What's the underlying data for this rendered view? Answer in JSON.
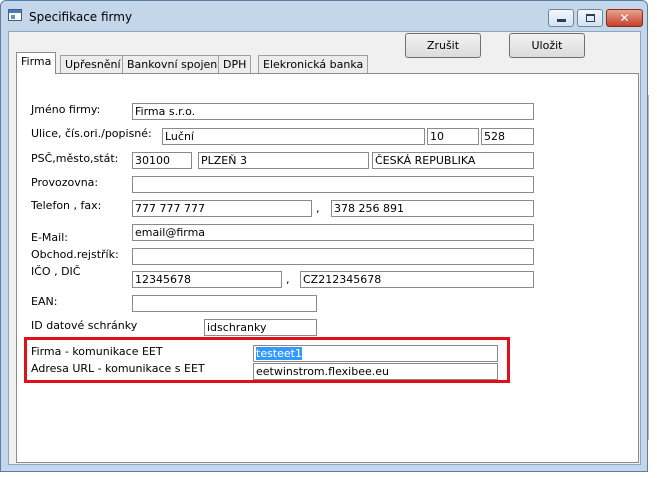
{
  "window": {
    "title": "Specifikace firmy",
    "close_glyph": "✕"
  },
  "toolbar": {
    "zrusit_label": "Zrušit",
    "ulozit_label": "Uložit"
  },
  "tabs": [
    {
      "label": "Firma",
      "active": true
    },
    {
      "label": "Upřesnění",
      "active": false
    },
    {
      "label": "Bankovní spojení",
      "active": false
    },
    {
      "label": "DPH",
      "active": false
    },
    {
      "label": "Elekronická banka",
      "active": false
    }
  ],
  "form": {
    "jmeno_label": "Jméno firmy:",
    "jmeno_value": "Firma s.r.o.",
    "ulice_label": "Ulice, čís.ori./popisné:",
    "ulice_value": "Luční",
    "cislo_ori_value": "10",
    "cislo_pop_value": "528",
    "psc_label": "PSČ,město,stát:",
    "psc_value": "30100",
    "mesto_value": "PLZEŇ 3",
    "stat_value": "ČESKÁ REPUBLIKA",
    "provozovna_label": "Provozovna:",
    "provozovna_value": "",
    "telefon_label": "Telefon ,  fax:",
    "telefon_value": "777 777 777",
    "fax_value": "378 256 891",
    "separator": ",",
    "email_label": "E-Mail:",
    "email_value": "email@firma",
    "rejstrik_label": "Obchod.rejstřík:",
    "rejstrik_value": "",
    "ico_label": "IČO , DIČ",
    "ico_value": "12345678",
    "dic_value": "CZ212345678",
    "ean_label": "EAN:",
    "ean_value": "",
    "datova_label": "ID datové schránky",
    "datova_value": "idschranky",
    "eet_firma_label": "Firma - komunikace EET",
    "eet_firma_value": "testeet1",
    "eet_url_label": "Adresa URL - komunikace s EET",
    "eet_url_value": "eetwinstrom.flexibee.eu"
  },
  "colors": {
    "highlight": "#e0101a",
    "selection": "#3399ff"
  }
}
